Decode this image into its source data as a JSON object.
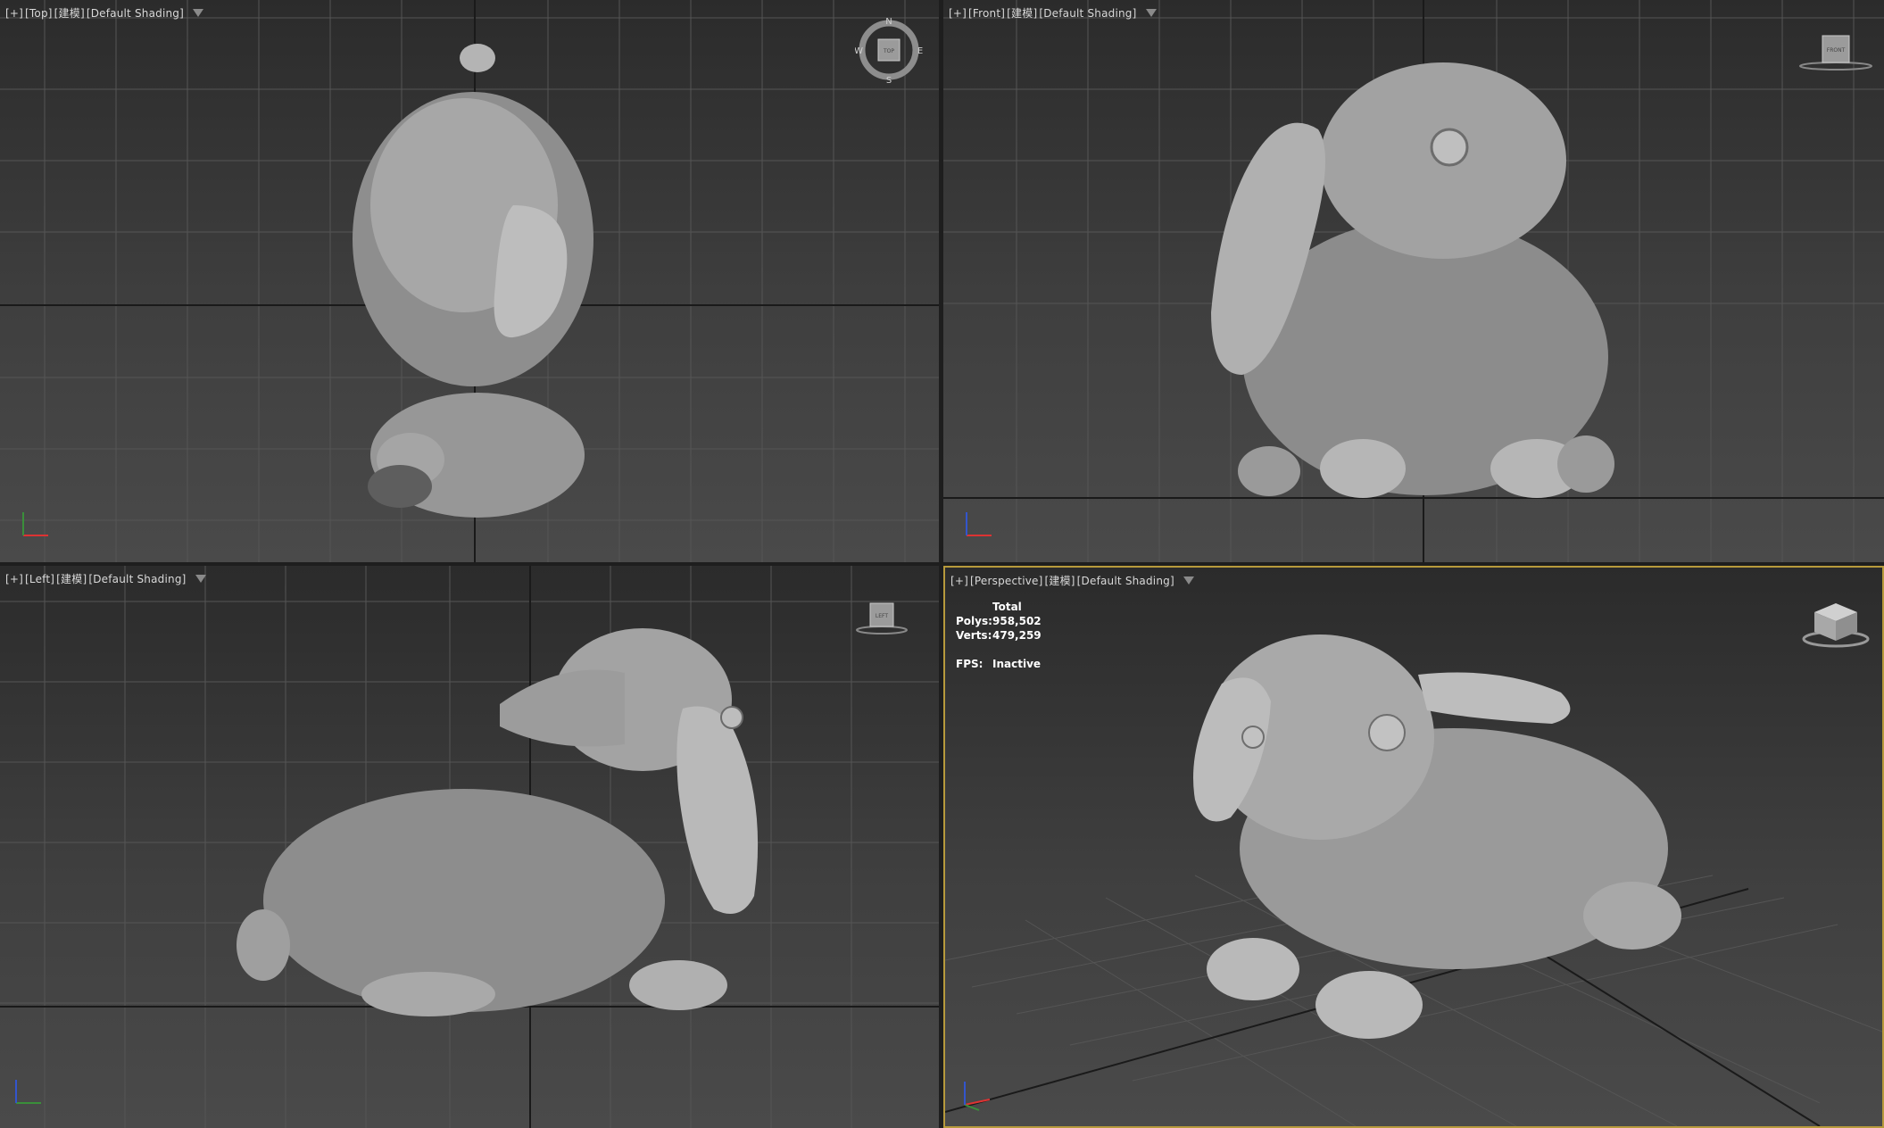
{
  "viewports": {
    "top": {
      "plus": "[+]",
      "view": "[Top]",
      "mode": "[建模]",
      "shading": "[Default Shading]"
    },
    "front": {
      "plus": "[+]",
      "view": "[Front]",
      "mode": "[建模]",
      "shading": "[Default Shading]"
    },
    "left": {
      "plus": "[+]",
      "view": "[Left]",
      "mode": "[建模]",
      "shading": "[Default Shading]"
    },
    "perspective": {
      "plus": "[+]",
      "view": "[Perspective]",
      "mode": "[建模]",
      "shading": "[Default Shading]",
      "stats": {
        "total_label": "Total",
        "polys_label": "Polys:",
        "polys_value": "958,502",
        "verts_label": "Verts:",
        "verts_value": "479,259",
        "fps_label": "FPS:",
        "fps_value": "Inactive"
      }
    }
  },
  "compass": {
    "n": "N",
    "s": "S",
    "e": "E",
    "w": "W",
    "cube_top": "TOP"
  },
  "viewcube_labels": {
    "front": "FRONT",
    "left": "LEFT"
  },
  "icons": {
    "filter": "filter-icon",
    "viewcube": "viewcube-icon",
    "axis_triad": "axis-triad-icon"
  },
  "colors": {
    "active_border": "#b79a3c",
    "viewport_bg": "#3a3a3a",
    "grid": "#5a5a5a"
  }
}
